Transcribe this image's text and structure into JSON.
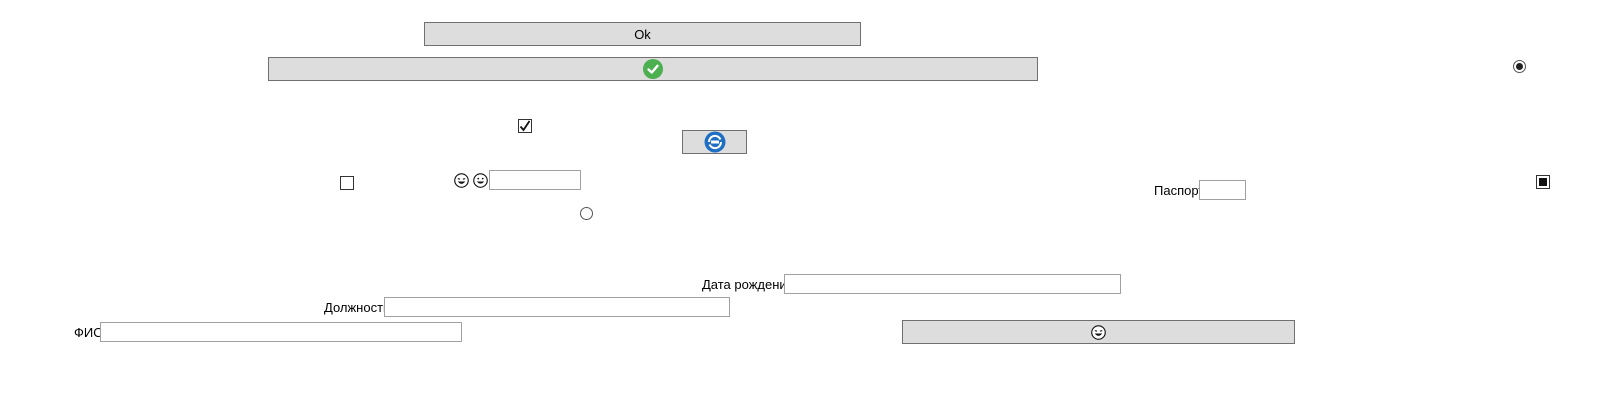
{
  "buttons": {
    "ok_label": "Ok",
    "confirm_icon": "check-circle-icon",
    "refresh_icon": "refresh-logo-icon",
    "emoji_icon": "laughing-face-icon"
  },
  "form": {
    "passport_label": "Паспорт",
    "birth_date_label": "Дата рождения",
    "position_label": "Должность",
    "name_label": "ФИО",
    "passport_value": "",
    "birth_date_value": "",
    "position_value": "",
    "name_value": "",
    "emoji_field_value": ""
  },
  "controls": {
    "checkbox_checked": true,
    "checkbox_unchecked": false,
    "radio_top_selected": true,
    "radio_middle_selected": false,
    "checkbox_right_state": "indeterminate"
  },
  "colors": {
    "button_bg": "#dddddd",
    "check_green": "#4caf50",
    "refresh_blue": "#1e6fc4"
  }
}
